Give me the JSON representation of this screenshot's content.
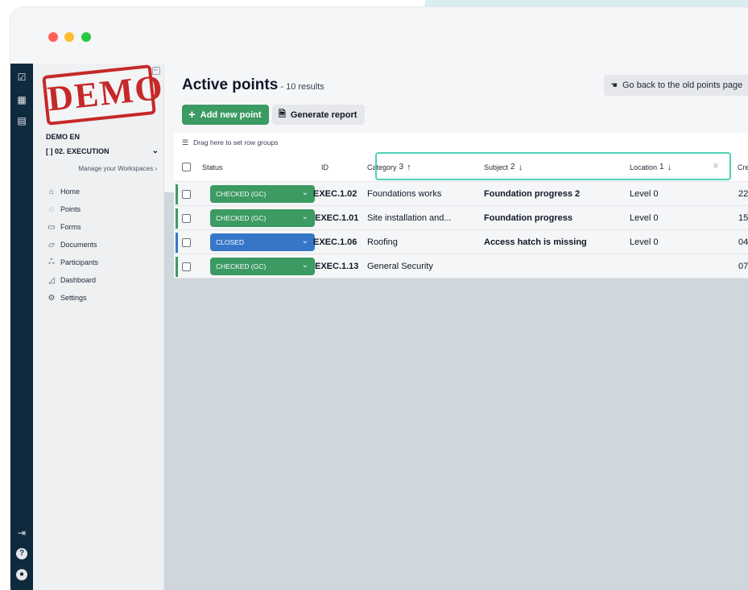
{
  "window": {
    "dots": [
      "close",
      "minimize",
      "maximize"
    ]
  },
  "rail": {
    "icons": [
      "checklist-icon",
      "buildings-icon",
      "grid-icon"
    ],
    "bottom_icons": [
      "logout-icon",
      "help-icon",
      "user-icon"
    ]
  },
  "sidebar": {
    "stamp": "DEMO",
    "workspace_title": "DEMO EN",
    "workspace_select": "02. EXECUTION",
    "manage_link": "Manage your Workspaces ›",
    "nav": [
      {
        "label": "Home",
        "icon": "home-icon"
      },
      {
        "label": "Points",
        "icon": "pin-icon"
      },
      {
        "label": "Forms",
        "icon": "clipboard-icon"
      },
      {
        "label": "Documents",
        "icon": "folder-icon"
      },
      {
        "label": "Participants",
        "icon": "people-icon"
      },
      {
        "label": "Dashboard",
        "icon": "chart-icon"
      },
      {
        "label": "Settings",
        "icon": "gear-icon"
      }
    ]
  },
  "header": {
    "title": "Active points",
    "results": " - 10 results",
    "add_button": "Add new point",
    "report_button": "Generate report",
    "old_points_button": "Go back to the old points page"
  },
  "groupbar": {
    "label": "Drag here to set row groups"
  },
  "table": {
    "columns": {
      "status": "Status",
      "id": "ID",
      "category": "Category",
      "category_sort": "3",
      "subject": "Subject",
      "subject_sort": "2",
      "location": "Location",
      "location_sort": "1",
      "creation": "Creation"
    },
    "rows": [
      {
        "status": "CHECKED (GC)",
        "status_color": "#3c9a63",
        "id": "EXEC.1.02",
        "category": "Foundations works",
        "subject": "Foundation progress 2",
        "location": "Level 0",
        "creation": "22"
      },
      {
        "status": "CHECKED (GC)",
        "status_color": "#3c9a63",
        "id": "EXEC.1.01",
        "category": "Site installation and...",
        "subject": "Foundation progress",
        "location": "Level 0",
        "creation": "15"
      },
      {
        "status": "CLOSED",
        "status_color": "#3576c9",
        "id": "EXEC.1.06",
        "category": "Roofing",
        "subject": "Access hatch is missing",
        "location": "Level 0",
        "creation": "04"
      },
      {
        "status": "CHECKED (GC)",
        "status_color": "#3c9a63",
        "id": "EXEC.1.13",
        "category": "General Security",
        "subject": "",
        "location": "",
        "creation": "07"
      }
    ]
  }
}
